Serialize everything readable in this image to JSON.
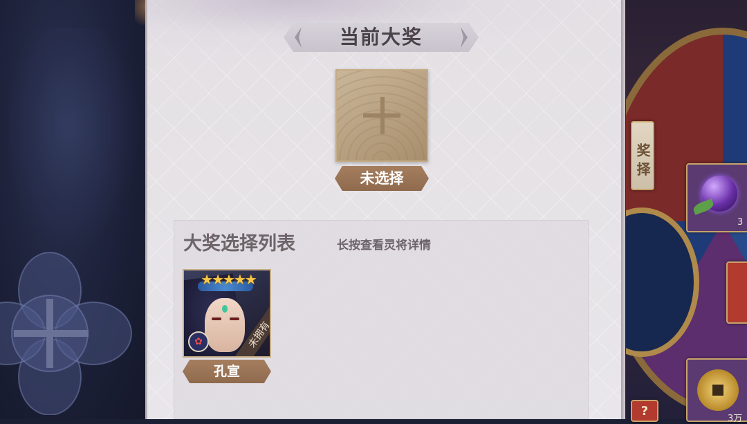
{
  "main_panel": {
    "title": "当前大奖",
    "current_prize": {
      "status_label": "未选择",
      "plus_icon": "plus-icon"
    },
    "list": {
      "title": "大奖选择列表",
      "hint": "长按查看灵将详情",
      "items": [
        {
          "name": "孔宣",
          "stars": "★★★★★",
          "star_count": 5,
          "ownership_ribbon": "未拥有",
          "faction_icon": "lotus-faction-icon"
        }
      ]
    }
  },
  "wheel": {
    "tile_label": "奖\n择",
    "question_mark": "?",
    "partial_counts": [
      "3",
      "3万"
    ]
  },
  "colors": {
    "panel_bg": "#e6e3e8",
    "tag_brown": "#9a7456",
    "slot_tan": "#b9a283",
    "star_gold": "#f7c846"
  }
}
